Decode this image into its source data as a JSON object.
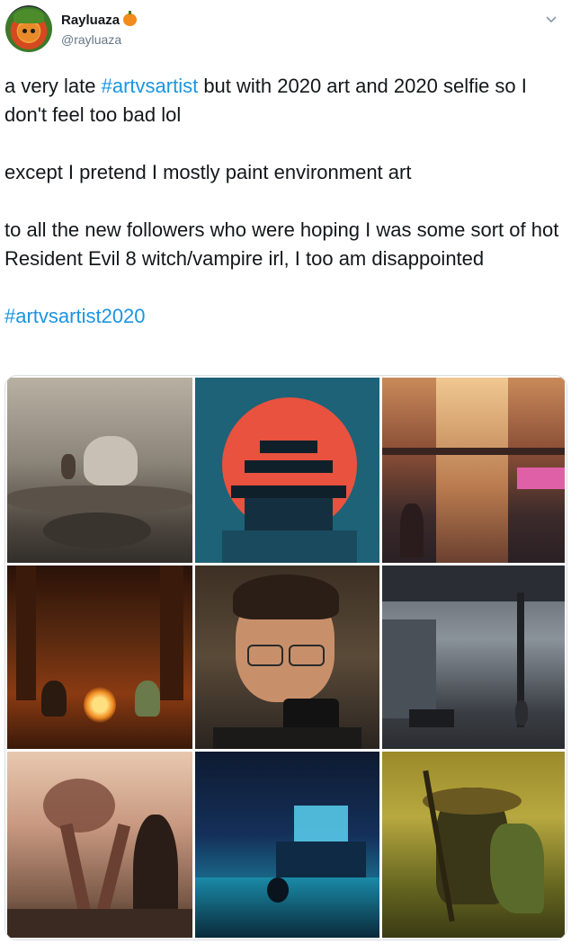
{
  "user": {
    "display_name": "Rayluaza",
    "handle": "@rayluaza",
    "name_emoji": "pumpkin-icon"
  },
  "tweet": {
    "line1_before": "a very late ",
    "line1_hashtag": "#artvsartist",
    "line1_after": " but with 2020 art and 2020 selfie so I don't feel too bad lol",
    "paragraph2": "except I pretend I mostly paint environment art",
    "paragraph3": "to all the new followers who were hoping I was some sort of hot Resident Evil 8 witch/vampire irl, I too am disappointed",
    "hashtag_final": "#artvsartist2020"
  },
  "colors": {
    "hashtag": "#1b95e0",
    "text": "#14171a",
    "secondary": "#657786"
  },
  "media_grid": {
    "tiles": [
      "bear-and-child-on-fallen-log-painting",
      "red-sun-pagoda-painting",
      "sunlit-market-alley-painting",
      "campfire-forest-painting",
      "artist-selfie-photo",
      "train-station-platform-painting",
      "giant-creature-silhouette-painting",
      "blue-lit-room-painting",
      "forest-witch-with-staff-painting"
    ]
  }
}
